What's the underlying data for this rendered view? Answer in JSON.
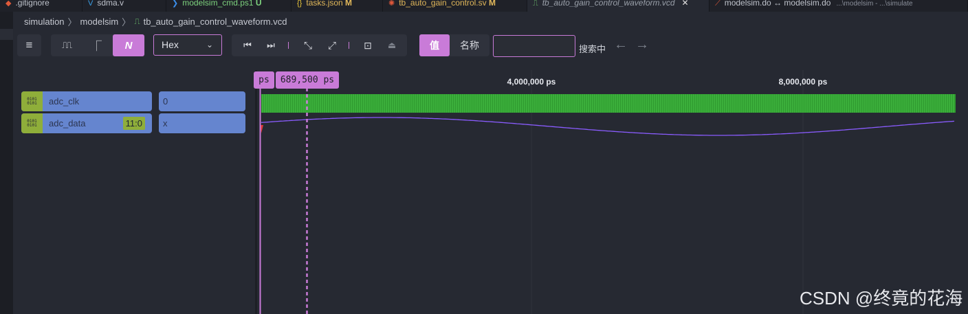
{
  "tabs": [
    {
      "icon": "git-icon",
      "glyph": "◆",
      "color": "#e05a3a",
      "label": ".gitignore",
      "badge": "",
      "text_color": "#bfc3cc"
    },
    {
      "icon": "verilog-icon",
      "glyph": "V",
      "color": "#3aa0e8",
      "label": "sdma.v",
      "badge": "",
      "text_color": "#bfc3cc"
    },
    {
      "icon": "powershell-icon",
      "glyph": "❯",
      "color": "#3b8eea",
      "label": "modelsim_cmd.ps1",
      "badge": "U",
      "text_color": "#7ed37e"
    },
    {
      "icon": "json-icon",
      "glyph": "{}",
      "color": "#e8c53a",
      "label": "tasks.json",
      "badge": "M",
      "text_color": "#e2b85a"
    },
    {
      "icon": "sv-icon",
      "glyph": "✺",
      "color": "#e0583a",
      "label": "tb_auto_gain_control.sv",
      "badge": "M",
      "text_color": "#e2b85a"
    },
    {
      "icon": "waveform-icon",
      "glyph": "⎍",
      "color": "#6ec36e",
      "label": "tb_auto_gain_control_waveform.vcd",
      "badge": "",
      "text_color": "#9aa0aa",
      "close": "✕"
    },
    {
      "icon": "diff-icon",
      "glyph": "⟋",
      "color": "#e0583a",
      "label": "modelsim.do ↔ modelsim.do",
      "badge": "",
      "text_color": "#bfc3cc",
      "path": "...\\modelsim - ...\\simulate"
    }
  ],
  "breadcrumb": {
    "items": [
      "simulation",
      "modelsim",
      "tb_auto_gain_control_waveform.vcd"
    ],
    "separator": "〉"
  },
  "toolbar": {
    "menu_glyph": "≡",
    "view_modes": [
      {
        "name": "digital-mode-icon",
        "glyph": "⎍⎍",
        "on": false
      },
      {
        "name": "step-mode-icon",
        "glyph": "⎾",
        "on": false
      },
      {
        "name": "analog-mode-icon",
        "glyph": "N",
        "on": true
      }
    ],
    "radix": "Hex",
    "radix_chevron": "⌄",
    "nav_glyphs": [
      "⏮",
      "⏭",
      "⤡",
      "⤢",
      "⊡",
      "⏏"
    ],
    "search_tabs": {
      "value": "值",
      "name": "名称"
    },
    "search_placeholder": "",
    "search_status": "搜索中",
    "prev_glyph": "←",
    "next_glyph": "→"
  },
  "signals": [
    {
      "name": "adc_clk",
      "range": "",
      "value": "0"
    },
    {
      "name": "adc_data",
      "range": "11:0",
      "value": "x"
    }
  ],
  "signal_icon_text": [
    "0101",
    "0101"
  ],
  "timeline": {
    "ticks": [
      "4,000,000 ps",
      "8,000,000 ps"
    ],
    "cursor_unit": "ps",
    "cursor_time": "689,500 ps"
  },
  "colors": {
    "accent": "#c97bd8",
    "clock_fill": "#2f9a2f",
    "analog_line": "#8a5cff",
    "signal_bg": "#6585cf",
    "signal_icon": "#8fae3a"
  },
  "watermark": "CSDN @终竟的花海"
}
